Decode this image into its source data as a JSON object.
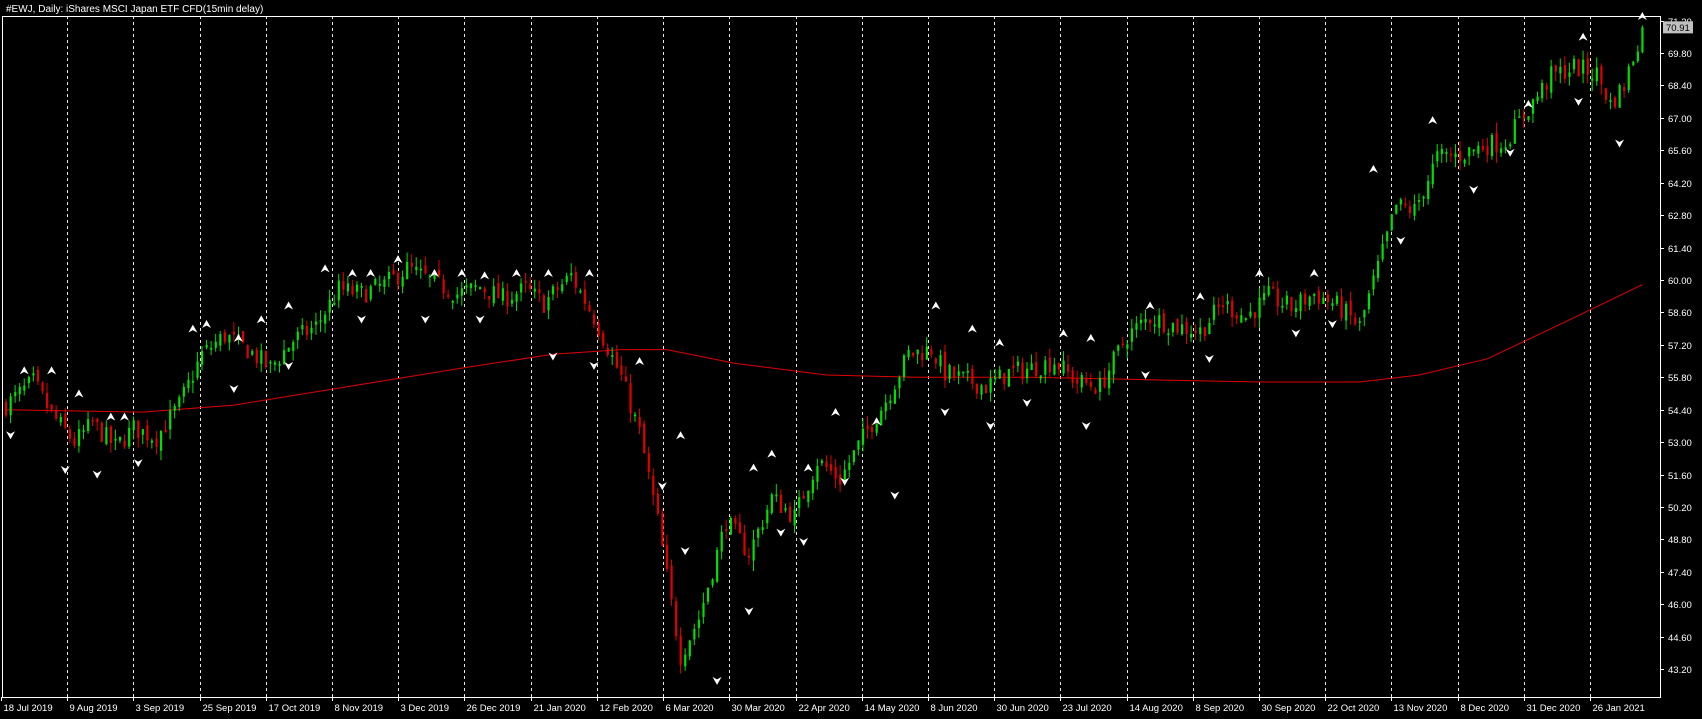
{
  "window": {
    "title": "#EWJ, Daily:  iShares MSCI Japan ETF CFD(15min delay)"
  },
  "colors": {
    "background": "#000000",
    "grid": "#ffffff",
    "axis": "#ffffff",
    "bull_candle": "#00e000",
    "bear_candle": "#e00000",
    "moving_average": "#e00000",
    "fractal": "#ffffff",
    "price_tag_bg": "#c0c0c0"
  },
  "chart_data": {
    "type": "candlestick",
    "symbol": "#EWJ",
    "timeframe": "Daily",
    "ylim": [
      42.0,
      71.4
    ],
    "y_ticks": [
      71.2,
      69.8,
      68.4,
      67.0,
      65.6,
      64.2,
      62.8,
      61.4,
      60.0,
      58.6,
      57.2,
      55.8,
      54.4,
      53.0,
      51.6,
      50.2,
      48.8,
      47.4,
      46.0,
      44.6,
      43.2
    ],
    "current_price": 70.91,
    "x_labels": [
      "18 Jul 2019",
      "9 Aug 2019",
      "3 Sep 2019",
      "25 Sep 2019",
      "17 Oct 2019",
      "8 Nov 2019",
      "3 Dec 2019",
      "26 Dec 2019",
      "21 Jan 2020",
      "12 Feb 2020",
      "6 Mar 2020",
      "30 Mar 2020",
      "22 Apr 2020",
      "14 May 2020",
      "8 Jun 2020",
      "30 Jun 2020",
      "23 Jul 2020",
      "14 Aug 2020",
      "8 Sep 2020",
      "30 Sep 2020",
      "22 Oct 2020",
      "13 Nov 2020",
      "8 Dec 2020",
      "31 Dec 2020",
      "26 Jan 2021"
    ],
    "close_path": [
      [
        0,
        54.6
      ],
      [
        6,
        55.6
      ],
      [
        10,
        54.2
      ],
      [
        15,
        53.0
      ],
      [
        19,
        53.8
      ],
      [
        24,
        52.8
      ],
      [
        28,
        53.6
      ],
      [
        33,
        53.2
      ],
      [
        38,
        54.6
      ],
      [
        43,
        56.8
      ],
      [
        48,
        57.6
      ],
      [
        53,
        57.0
      ],
      [
        58,
        56.2
      ],
      [
        63,
        57.4
      ],
      [
        68,
        58.0
      ],
      [
        73,
        59.6
      ],
      [
        78,
        59.4
      ],
      [
        83,
        59.8
      ],
      [
        88,
        60.5
      ],
      [
        93,
        60.0
      ],
      [
        99,
        59.4
      ],
      [
        104,
        59.7
      ],
      [
        109,
        59.2
      ],
      [
        114,
        59.6
      ],
      [
        118,
        59.0
      ],
      [
        124,
        60.2
      ],
      [
        129,
        58.4
      ],
      [
        135,
        55.8
      ],
      [
        139,
        53.4
      ],
      [
        143,
        49.6
      ],
      [
        146,
        46.0
      ],
      [
        148,
        43.8
      ],
      [
        152,
        45.4
      ],
      [
        158,
        49.6
      ],
      [
        163,
        48.2
      ],
      [
        168,
        50.6
      ],
      [
        173,
        49.8
      ],
      [
        178,
        52.2
      ],
      [
        183,
        51.4
      ],
      [
        188,
        53.2
      ],
      [
        193,
        54.8
      ],
      [
        198,
        56.8
      ],
      [
        203,
        57.0
      ],
      [
        206,
        56.0
      ],
      [
        209,
        55.8
      ],
      [
        215,
        55.4
      ],
      [
        220,
        56.0
      ],
      [
        225,
        56.2
      ],
      [
        230,
        56.5
      ],
      [
        235,
        55.6
      ],
      [
        240,
        55.4
      ],
      [
        246,
        57.6
      ],
      [
        251,
        58.4
      ],
      [
        257,
        58.0
      ],
      [
        262,
        57.8
      ],
      [
        267,
        59.0
      ],
      [
        272,
        58.4
      ],
      [
        277,
        59.3
      ],
      [
        282,
        58.8
      ],
      [
        287,
        59.4
      ],
      [
        292,
        58.9
      ],
      [
        297,
        58.0
      ],
      [
        302,
        61.2
      ],
      [
        305,
        63.2
      ],
      [
        309,
        63.0
      ],
      [
        314,
        65.3
      ],
      [
        319,
        65.4
      ],
      [
        324,
        65.8
      ],
      [
        329,
        66.0
      ],
      [
        334,
        67.4
      ],
      [
        339,
        68.8
      ],
      [
        344,
        69.2
      ],
      [
        349,
        68.9
      ],
      [
        352,
        67.6
      ],
      [
        355,
        68.4
      ],
      [
        359,
        70.91
      ]
    ],
    "moving_average": [
      [
        0,
        54.4
      ],
      [
        30,
        54.3
      ],
      [
        50,
        54.6
      ],
      [
        75,
        55.4
      ],
      [
        100,
        56.2
      ],
      [
        120,
        56.8
      ],
      [
        135,
        57.0
      ],
      [
        145,
        57.0
      ],
      [
        160,
        56.4
      ],
      [
        180,
        55.9
      ],
      [
        200,
        55.8
      ],
      [
        225,
        55.8
      ],
      [
        250,
        55.7
      ],
      [
        275,
        55.6
      ],
      [
        297,
        55.6
      ],
      [
        310,
        55.9
      ],
      [
        325,
        56.6
      ],
      [
        340,
        58.0
      ],
      [
        359,
        59.8
      ]
    ],
    "fractals_up": [
      [
        4,
        55.8
      ],
      [
        10,
        55.8
      ],
      [
        16,
        54.8
      ],
      [
        23,
        53.8
      ],
      [
        26,
        53.8
      ],
      [
        41,
        57.6
      ],
      [
        44,
        57.8
      ],
      [
        51,
        57.2
      ],
      [
        56,
        58.0
      ],
      [
        62,
        58.6
      ],
      [
        70,
        60.2
      ],
      [
        76,
        60.0
      ],
      [
        80,
        60.0
      ],
      [
        86,
        60.6
      ],
      [
        94,
        60.0
      ],
      [
        100,
        60.0
      ],
      [
        105,
        59.9
      ],
      [
        112,
        60.0
      ],
      [
        119,
        60.0
      ],
      [
        128,
        60.0
      ],
      [
        139,
        56.2
      ],
      [
        148,
        53.0
      ],
      [
        164,
        51.6
      ],
      [
        168,
        52.2
      ],
      [
        176,
        51.6
      ],
      [
        182,
        54.0
      ],
      [
        191,
        53.6
      ],
      [
        204,
        58.6
      ],
      [
        212,
        57.6
      ],
      [
        218,
        57.0
      ],
      [
        232,
        57.4
      ],
      [
        238,
        57.2
      ],
      [
        251,
        58.6
      ],
      [
        262,
        59.0
      ],
      [
        275,
        60.0
      ],
      [
        287,
        60.0
      ],
      [
        300,
        64.5
      ],
      [
        313,
        66.6
      ],
      [
        334,
        67.3
      ],
      [
        346,
        70.2
      ],
      [
        359,
        71.1
      ]
    ],
    "fractals_down": [
      [
        1,
        53.6
      ],
      [
        13,
        52.1
      ],
      [
        20,
        51.9
      ],
      [
        29,
        52.4
      ],
      [
        50,
        55.6
      ],
      [
        62,
        56.6
      ],
      [
        78,
        58.6
      ],
      [
        92,
        58.6
      ],
      [
        104,
        58.6
      ],
      [
        120,
        57.0
      ],
      [
        129,
        56.6
      ],
      [
        144,
        51.4
      ],
      [
        149,
        48.6
      ],
      [
        156,
        43.0
      ],
      [
        163,
        46.0
      ],
      [
        170,
        49.4
      ],
      [
        175,
        49.0
      ],
      [
        184,
        51.6
      ],
      [
        195,
        51.0
      ],
      [
        206,
        54.6
      ],
      [
        216,
        54.0
      ],
      [
        224,
        55.0
      ],
      [
        237,
        54.0
      ],
      [
        250,
        56.2
      ],
      [
        264,
        56.9
      ],
      [
        283,
        58.0
      ],
      [
        291,
        58.4
      ],
      [
        306,
        62.0
      ],
      [
        322,
        64.2
      ],
      [
        330,
        65.8
      ],
      [
        345,
        68.0
      ],
      [
        354,
        66.2
      ]
    ]
  }
}
